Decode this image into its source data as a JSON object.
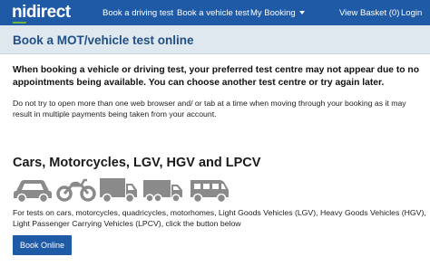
{
  "header": {
    "logo": {
      "ni": "ni",
      "direct": "direct"
    },
    "nav": [
      {
        "label": "Book a driving test"
      },
      {
        "label": "Book a vehicle test"
      },
      {
        "label": "My Booking",
        "icon": "caret-down-icon"
      },
      {
        "label": "View Basket (0)"
      },
      {
        "label": "Login"
      }
    ]
  },
  "page": {
    "title": "Book a MOT/vehicle test online"
  },
  "notice": {
    "warning": "When booking a vehicle or driving test, your preferred test centre may not appear due to no appointments being available. You can choose another test centre or try again later.",
    "info": "Do not try to open more than one web browser and/ or tab at a time when moving through your booking as it may result in multiple payments being taken from your account."
  },
  "section": {
    "title": "Cars, Motorcycles, LGV, HGV and LPCV",
    "icons": [
      "car-icon",
      "motorcycle-icon",
      "lgv-van-icon",
      "hgv-truck-icon",
      "minibus-icon"
    ],
    "description": "For tests on cars, motorcycles, quadricycles, motorhomes, Light Goods Vehicles (LGV), Heavy Goods Vehicles (HGV), Light Passenger Carrying Vehicles (LPCV), click the button below",
    "button_label": "Book Online"
  },
  "colors": {
    "brand_blue": "#1f5aa6",
    "header_band": "#dfe7ef",
    "icon_grey": "#8a8a8a",
    "logo_accent": "#6fb23f"
  }
}
